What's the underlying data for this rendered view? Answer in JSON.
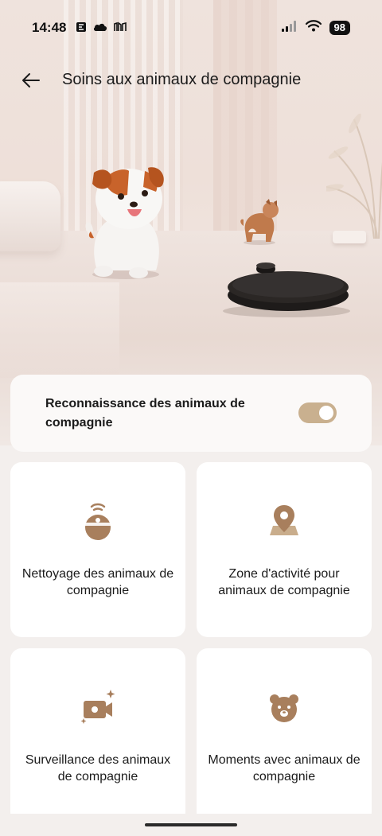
{
  "status_bar": {
    "time": "14:48",
    "icons": [
      "news-app-icon",
      "cloud-icon",
      "newspaper-icon"
    ],
    "battery": "98"
  },
  "header": {
    "title": "Soins aux animaux de compagnie",
    "back_icon": "arrow-left-icon"
  },
  "pet_recognition": {
    "label": "Reconnaissance des animaux de compagnie",
    "enabled": true
  },
  "features": [
    {
      "label": "Nettoyage des animaux de compagnie",
      "icon": "robot-vacuum-icon"
    },
    {
      "label": "Zone d'activité pour animaux de compagnie",
      "icon": "map-pin-icon"
    },
    {
      "label": "Surveillance des animaux de compagnie",
      "icon": "video-camera-icon"
    },
    {
      "label": "Moments avec animaux de compagnie",
      "icon": "pet-face-icon"
    }
  ],
  "colors": {
    "accent": "#c9b08f",
    "icon": "#a87f5d",
    "card_bg": "#ffffff",
    "page_bg": "#f3efed"
  }
}
